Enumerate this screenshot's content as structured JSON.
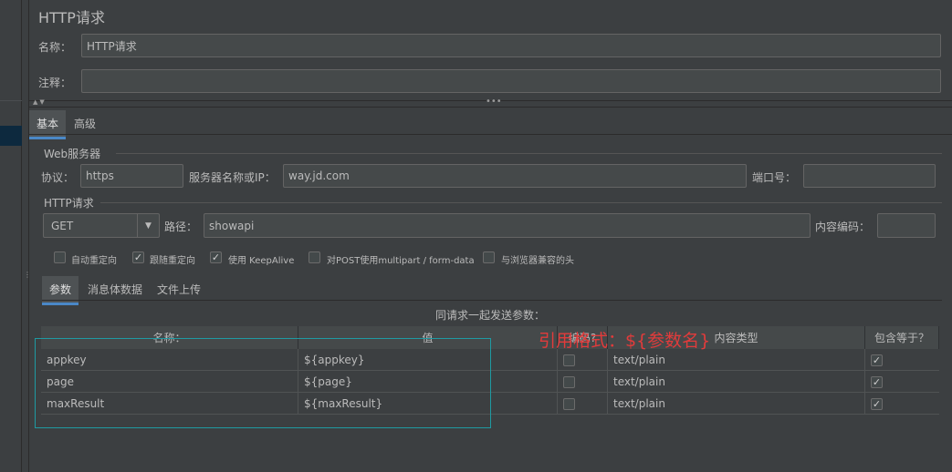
{
  "panel": {
    "title": "HTTP请求",
    "name_label": "名称：",
    "name_value": "HTTP请求",
    "comment_label": "注释：",
    "comment_value": ""
  },
  "tabs": [
    {
      "label": "基本",
      "active": true
    },
    {
      "label": "高级",
      "active": false
    }
  ],
  "web_server": {
    "section_title": "Web服务器",
    "protocol_label": "协议：",
    "protocol_value": "https",
    "server_label": "服务器名称或IP：",
    "server_value": "way.jd.com",
    "port_label": "端口号：",
    "port_value": ""
  },
  "http_request": {
    "section_title": "HTTP请求",
    "method_value": "GET",
    "path_label": "路径：",
    "path_value": "showapi",
    "encoding_label": "内容编码：",
    "encoding_value": ""
  },
  "options": [
    {
      "label": "自动重定向",
      "checked": false
    },
    {
      "label": "跟随重定向",
      "checked": true
    },
    {
      "label": "使用 KeepAlive",
      "checked": true
    },
    {
      "label": "对POST使用multipart / form-data",
      "checked": false
    },
    {
      "label": "与浏览器兼容的头",
      "checked": false
    }
  ],
  "sub_tabs": [
    {
      "label": "参数",
      "active": true
    },
    {
      "label": "消息体数据",
      "active": false
    },
    {
      "label": "文件上传",
      "active": false
    }
  ],
  "params_table": {
    "caption": "同请求一起发送参数：",
    "columns": [
      "名称：",
      "值",
      "编码?",
      "内容类型",
      "包含等于？"
    ],
    "rows": [
      {
        "name": "appkey",
        "value": "${appkey}",
        "encode": false,
        "content_type": "text/plain",
        "include_equals": true
      },
      {
        "name": "page",
        "value": "${page}",
        "encode": false,
        "content_type": "text/plain",
        "include_equals": true
      },
      {
        "name": "maxResult",
        "value": "${maxResult}",
        "encode": false,
        "content_type": "text/plain",
        "include_equals": true
      }
    ]
  },
  "annotation": {
    "text": "引用格式：${参数名}",
    "color": "#e23b3b",
    "box_color": "#1f9aa2"
  },
  "check_mark": "✓"
}
